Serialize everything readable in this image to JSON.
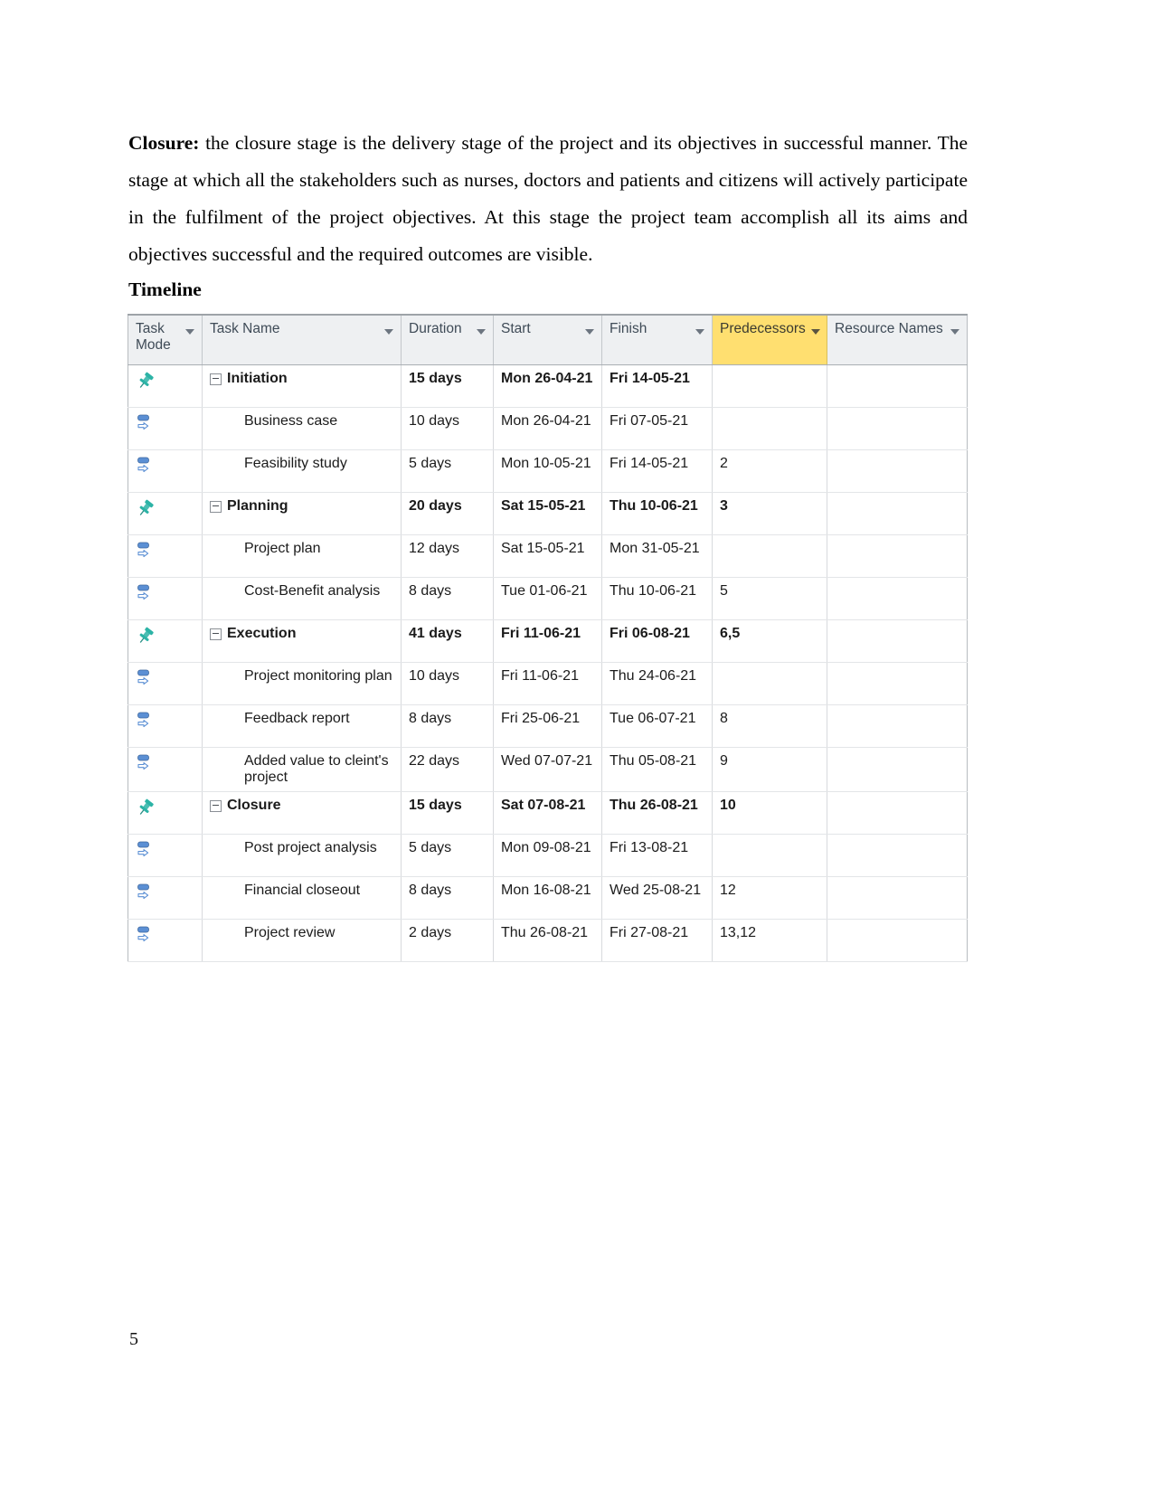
{
  "document": {
    "paragraph_lead": "Closure:",
    "paragraph_text": " the closure stage is the delivery stage of the project and its objectives in successful manner. The stage at which all the stakeholders such as nurses, doctors and patients and citizens will actively participate in the fulfilment of the project objectives. At this stage the project team accomplish all its aims and objectives successful and the required outcomes are visible.",
    "section_heading": "Timeline",
    "page_number": "5"
  },
  "table": {
    "headers": {
      "task_mode": "Task\nMode",
      "task_name": "Task Name",
      "duration": "Duration",
      "start": "Start",
      "finish": "Finish",
      "predecessors": "Predecessors",
      "resource_names": "Resource Names"
    },
    "highlight_color": "#ffdf70",
    "header_bg": "#eef0f2",
    "pin_icon_color": "#2cb3a6",
    "auto_icon_color": "#5b8fd4",
    "rows": [
      {
        "mode_icon": "pin-icon",
        "summary": true,
        "name": "Initiation",
        "duration": "15 days",
        "start": "Mon 26-04-21",
        "finish": "Fri 14-05-21",
        "predecessors": "",
        "resources": ""
      },
      {
        "mode_icon": "auto-schedule-icon",
        "summary": false,
        "name": "Business case",
        "duration": "10 days",
        "start": "Mon 26-04-21",
        "finish": "Fri 07-05-21",
        "predecessors": "",
        "resources": ""
      },
      {
        "mode_icon": "auto-schedule-icon",
        "summary": false,
        "name": "Feasibility study",
        "duration": "5 days",
        "start": "Mon 10-05-21",
        "finish": "Fri 14-05-21",
        "predecessors": "2",
        "resources": ""
      },
      {
        "mode_icon": "pin-icon",
        "summary": true,
        "name": "Planning",
        "duration": "20 days",
        "start": "Sat 15-05-21",
        "finish": "Thu 10-06-21",
        "predecessors": "3",
        "resources": ""
      },
      {
        "mode_icon": "auto-schedule-icon",
        "summary": false,
        "name": "Project plan",
        "duration": "12 days",
        "start": "Sat 15-05-21",
        "finish": "Mon 31-05-21",
        "predecessors": "",
        "resources": ""
      },
      {
        "mode_icon": "auto-schedule-icon",
        "summary": false,
        "name": "Cost-Benefit analysis",
        "duration": "8 days",
        "start": "Tue 01-06-21",
        "finish": "Thu 10-06-21",
        "predecessors": "5",
        "resources": ""
      },
      {
        "mode_icon": "pin-icon",
        "summary": true,
        "name": "Execution",
        "duration": "41 days",
        "start": "Fri 11-06-21",
        "finish": "Fri 06-08-21",
        "predecessors": "6,5",
        "resources": ""
      },
      {
        "mode_icon": "auto-schedule-icon",
        "summary": false,
        "name": "Project monitoring plan",
        "duration": "10 days",
        "start": "Fri 11-06-21",
        "finish": "Thu 24-06-21",
        "predecessors": "",
        "resources": ""
      },
      {
        "mode_icon": "auto-schedule-icon",
        "summary": false,
        "name": "Feedback report",
        "duration": "8 days",
        "start": "Fri 25-06-21",
        "finish": "Tue 06-07-21",
        "predecessors": "8",
        "resources": ""
      },
      {
        "mode_icon": "auto-schedule-icon",
        "summary": false,
        "name": "Added value to cleint's project",
        "duration": "22 days",
        "start": "Wed 07-07-21",
        "finish": "Thu 05-08-21",
        "predecessors": "9",
        "resources": ""
      },
      {
        "mode_icon": "pin-icon",
        "summary": true,
        "name": "Closure",
        "duration": "15 days",
        "start": "Sat 07-08-21",
        "finish": "Thu 26-08-21",
        "predecessors": "10",
        "resources": ""
      },
      {
        "mode_icon": "auto-schedule-icon",
        "summary": false,
        "name": "Post project analysis",
        "duration": "5 days",
        "start": "Mon 09-08-21",
        "finish": "Fri 13-08-21",
        "predecessors": "",
        "resources": ""
      },
      {
        "mode_icon": "auto-schedule-icon",
        "summary": false,
        "name": "Financial closeout",
        "duration": "8 days",
        "start": "Mon 16-08-21",
        "finish": "Wed 25-08-21",
        "predecessors": "12",
        "resources": ""
      },
      {
        "mode_icon": "auto-schedule-icon",
        "summary": false,
        "name": "Project review",
        "duration": "2 days",
        "start": "Thu 26-08-21",
        "finish": "Fri 27-08-21",
        "predecessors": "13,12",
        "resources": ""
      }
    ]
  }
}
